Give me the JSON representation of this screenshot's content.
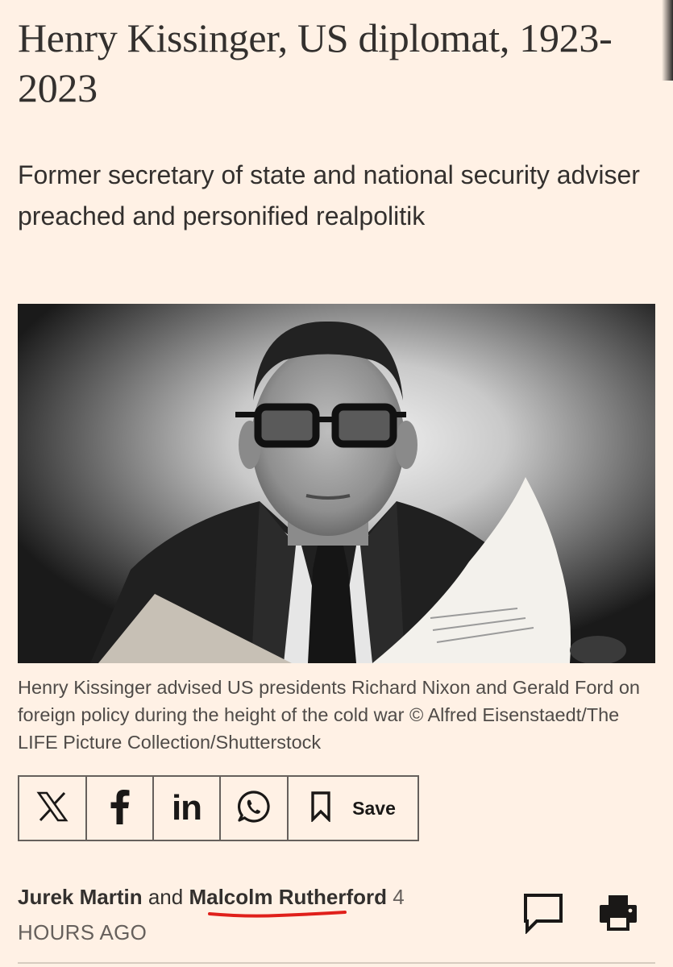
{
  "article": {
    "headline": "Henry Kissinger, US diplomat, 1923-2023",
    "standfirst": "Former secretary of state and national security adviser preached and personified realpolitik",
    "image": {
      "caption": "Henry Kissinger advised US presidents Richard Nixon and Gerald Ford on foreign policy during the height of the cold war © Alfred Eisenstaedt/The LIFE Picture Collection/Shutterstock"
    },
    "share": {
      "buttons": [
        {
          "icon": "x-icon"
        },
        {
          "icon": "facebook-icon"
        },
        {
          "icon": "linkedin-icon",
          "glyph": "in"
        },
        {
          "icon": "whatsapp-icon"
        },
        {
          "icon": "bookmark-icon",
          "label": "Save"
        }
      ]
    },
    "byline": {
      "author_1": "Jurek Martin",
      "conjunction": "and",
      "author_2": "Malcolm Rutherford",
      "time_number": "4",
      "time_unit": "HOURS AGO"
    },
    "actions": {
      "comment_icon": "comment-icon",
      "print_icon": "print-icon"
    }
  },
  "colors": {
    "background": "#fff1e5",
    "text": "#33302e",
    "underline_annotation": "#e0201b"
  }
}
